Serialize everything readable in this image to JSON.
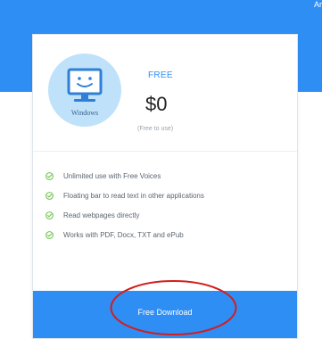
{
  "page": {
    "corner_text": "Ar"
  },
  "plan": {
    "os_label": "Windows",
    "os_icon": "monitor-smiley-icon",
    "name": "FREE",
    "price": "$0",
    "note": "(Free to use)"
  },
  "features": [
    "Unlimited use with Free Voices",
    "Floating bar to read text in other applications",
    "Read webpages directly",
    "Works with PDF, Docx, TXT and ePub"
  ],
  "cta": {
    "label": "Free Download"
  },
  "colors": {
    "accent_blue": "#2f8ef4",
    "check_green": "#6cc24a",
    "badge_bg": "#bfe2fa",
    "annotation_red": "#d21e1e"
  }
}
